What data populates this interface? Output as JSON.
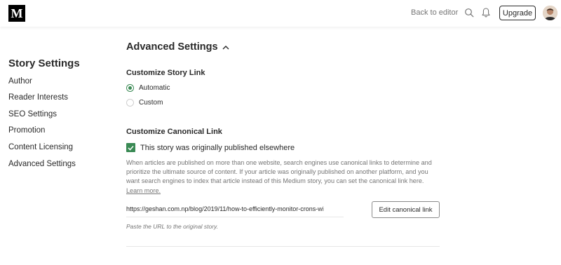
{
  "header": {
    "logo": "M",
    "back_to_editor": "Back to editor",
    "upgrade_label": "Upgrade",
    "icons": [
      "search-icon",
      "bell-icon"
    ],
    "avatar": "user avatar"
  },
  "sidebar": {
    "title": "Story Settings",
    "items": [
      {
        "label": "Author"
      },
      {
        "label": "Reader Interests"
      },
      {
        "label": "SEO Settings"
      },
      {
        "label": "Promotion"
      },
      {
        "label": "Content Licensing"
      },
      {
        "label": "Advanced Settings"
      }
    ]
  },
  "main": {
    "section_title": "Advanced Settings",
    "story_link": {
      "title": "Customize Story Link",
      "options": [
        {
          "label": "Automatic",
          "selected": true
        },
        {
          "label": "Custom",
          "selected": false
        }
      ]
    },
    "canonical": {
      "title": "Customize Canonical Link",
      "checkbox_label": "This story was originally published elsewhere",
      "checked": true,
      "description": "When articles are published on more than one website, search engines use canonical links to determine and prioritize the ultimate source of content. If your article was originally published on another platform, and you want search engines to index that article instead of this Medium story, you can set the canonical link here.",
      "learn_more": "Learn more.",
      "url_value": "https://geshan.com.np/blog/2019/11/how-to-efficiently-monitor-crons-wi",
      "edit_button": "Edit canonical link",
      "hint": "Paste the URL to the original story."
    }
  },
  "colors": {
    "accent_green": "#3a8a54",
    "text": "#292929",
    "muted": "#757575"
  }
}
